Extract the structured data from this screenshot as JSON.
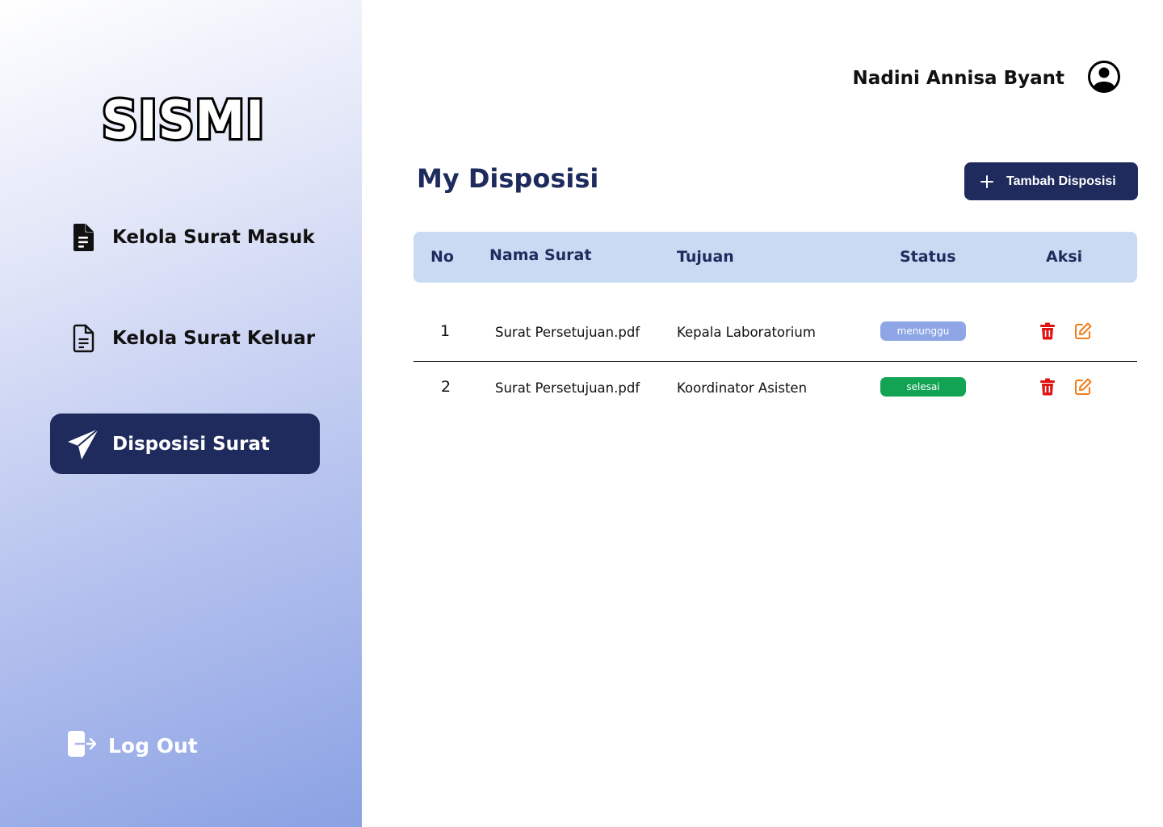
{
  "app": {
    "logo_text": "SISMI"
  },
  "sidebar": {
    "items": [
      {
        "label": "Kelola Surat Masuk",
        "icon": "file-filled-icon",
        "active": false
      },
      {
        "label": "Kelola Surat  Keluar",
        "icon": "file-outline-icon",
        "active": false
      },
      {
        "label": "Disposisi Surat",
        "icon": "paper-plane-icon",
        "active": true
      }
    ],
    "logout_label": "Log Out",
    "active_color": "#1e2b5c"
  },
  "header": {
    "user_name": "Nadini Annisa Byant",
    "avatar_icon": "user-circle-icon"
  },
  "main": {
    "title": "My Disposisi",
    "add_button_label": "Tambah Disposisi",
    "add_button_icon": "plus-icon",
    "table": {
      "headers": {
        "no": "No",
        "nama_surat": "Nama Surat",
        "tujuan": "Tujuan",
        "status": "Status",
        "aksi": "Aksi"
      },
      "rows": [
        {
          "no": "1",
          "nama_surat": "Surat Persetujuan.pdf",
          "tujuan": "Kepala Laboratorium",
          "status": "menunggu",
          "status_color": "#8ea6e6"
        },
        {
          "no": "2",
          "nama_surat": "Surat Persetujuan.pdf",
          "tujuan": "Koordinator Asisten",
          "status": "selesai",
          "status_color": "#12a454"
        }
      ],
      "header_bg": "#c9dbf3"
    }
  },
  "colors": {
    "primary": "#1e2b5c",
    "delete": "#e01414",
    "edit": "#f07c1a"
  }
}
